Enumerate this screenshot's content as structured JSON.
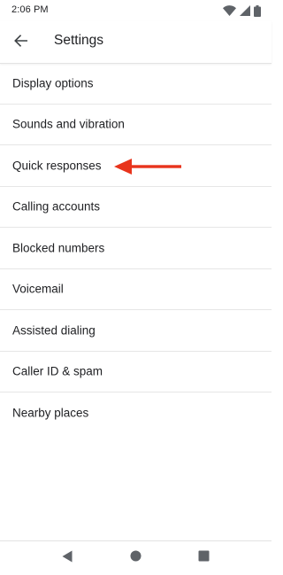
{
  "status_bar": {
    "time": "2:06 PM",
    "icons": [
      "wifi-icon",
      "cellular-signal-icon",
      "battery-icon"
    ]
  },
  "app_bar": {
    "back_icon": "arrow-back-icon",
    "title": "Settings"
  },
  "settings": {
    "items": [
      {
        "label": "Display options"
      },
      {
        "label": "Sounds and vibration"
      },
      {
        "label": "Quick responses"
      },
      {
        "label": "Calling accounts"
      },
      {
        "label": "Blocked numbers"
      },
      {
        "label": "Voicemail"
      },
      {
        "label": "Assisted dialing"
      },
      {
        "label": "Caller ID & spam"
      },
      {
        "label": "Nearby places"
      }
    ]
  },
  "annotation": {
    "icon": "red-arrow-icon",
    "color": "#e8341c"
  },
  "nav_bar": {
    "buttons": [
      "nav-back-icon",
      "nav-home-icon",
      "nav-recents-icon"
    ]
  }
}
